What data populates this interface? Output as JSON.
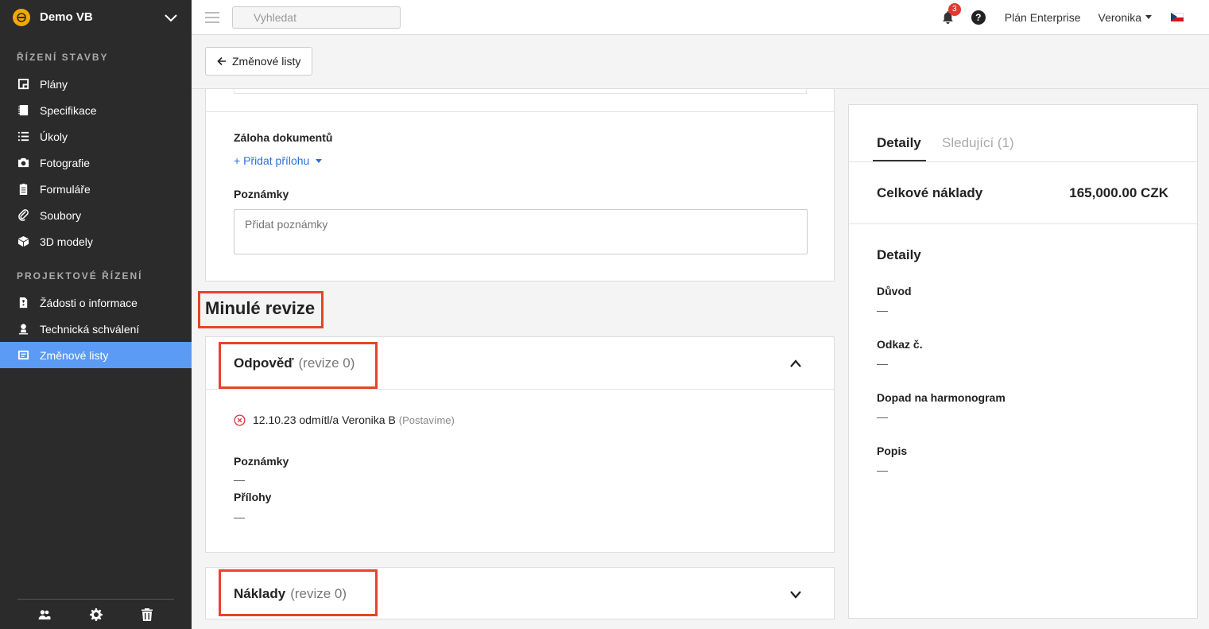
{
  "sidebar": {
    "project_name": "Demo VB",
    "section_construction": "ŘÍZENÍ STAVBY",
    "section_project": "PROJEKTOVÉ ŘÍZENÍ",
    "items": [
      {
        "label": "Plány",
        "icon": "plans-icon"
      },
      {
        "label": "Specifikace",
        "icon": "specifications-icon"
      },
      {
        "label": "Úkoly",
        "icon": "tasks-icon"
      },
      {
        "label": "Fotografie",
        "icon": "camera-icon"
      },
      {
        "label": "Formuláře",
        "icon": "clipboard-icon"
      },
      {
        "label": "Soubory",
        "icon": "paperclip-icon"
      },
      {
        "label": "3D modely",
        "icon": "cube-icon"
      },
      {
        "label": "Žádosti o informace",
        "icon": "rfi-icon"
      },
      {
        "label": "Technická schválení",
        "icon": "approval-icon"
      },
      {
        "label": "Změnové listy",
        "icon": "change-order-icon",
        "active": true
      }
    ],
    "footer_icons": [
      "users-icon",
      "gear-icon",
      "trash-icon"
    ]
  },
  "topbar": {
    "search_placeholder": "Vyhledat",
    "notification_count": "3",
    "help": "?",
    "plan": "Plán Enterprise",
    "user": "Veronika",
    "language_flag": "cz-flag-icon"
  },
  "subheader": {
    "back_label": "Změnové listy"
  },
  "form": {
    "backup_label": "Záloha dokumentů",
    "add_attachment": "+ Přidat přílohu",
    "notes_label": "Poznámky",
    "notes_placeholder": "Přidat poznámky"
  },
  "past_revisions": {
    "title": "Minulé revize",
    "response": {
      "title": "Odpověď",
      "revision": "(revize 0)",
      "status_text": "12.10.23 odmítl/a Veronika B",
      "status_company": "(Postavíme)",
      "notes_label": "Poznámky",
      "notes_value": "—",
      "attachments_label": "Přílohy",
      "attachments_value": "—"
    },
    "costs": {
      "title": "Náklady",
      "revision": "(revize 0)"
    }
  },
  "panel": {
    "tab_details": "Detaily",
    "tab_followers": "Sledující (1)",
    "total_cost_label": "Celkové náklady",
    "total_cost_value": "165,000.00 CZK",
    "details_title": "Detaily",
    "fields": [
      {
        "label": "Důvod",
        "value": "—"
      },
      {
        "label": "Odkaz č.",
        "value": "—"
      },
      {
        "label": "Dopad na harmonogram",
        "value": "—"
      },
      {
        "label": "Popis",
        "value": "—"
      }
    ]
  },
  "colors": {
    "sidebar_bg": "#2b2b2b",
    "active_nav": "#5b9bf5",
    "link": "#2b6fd6",
    "highlight": "#e8432b",
    "badge": "#e03a2e"
  }
}
